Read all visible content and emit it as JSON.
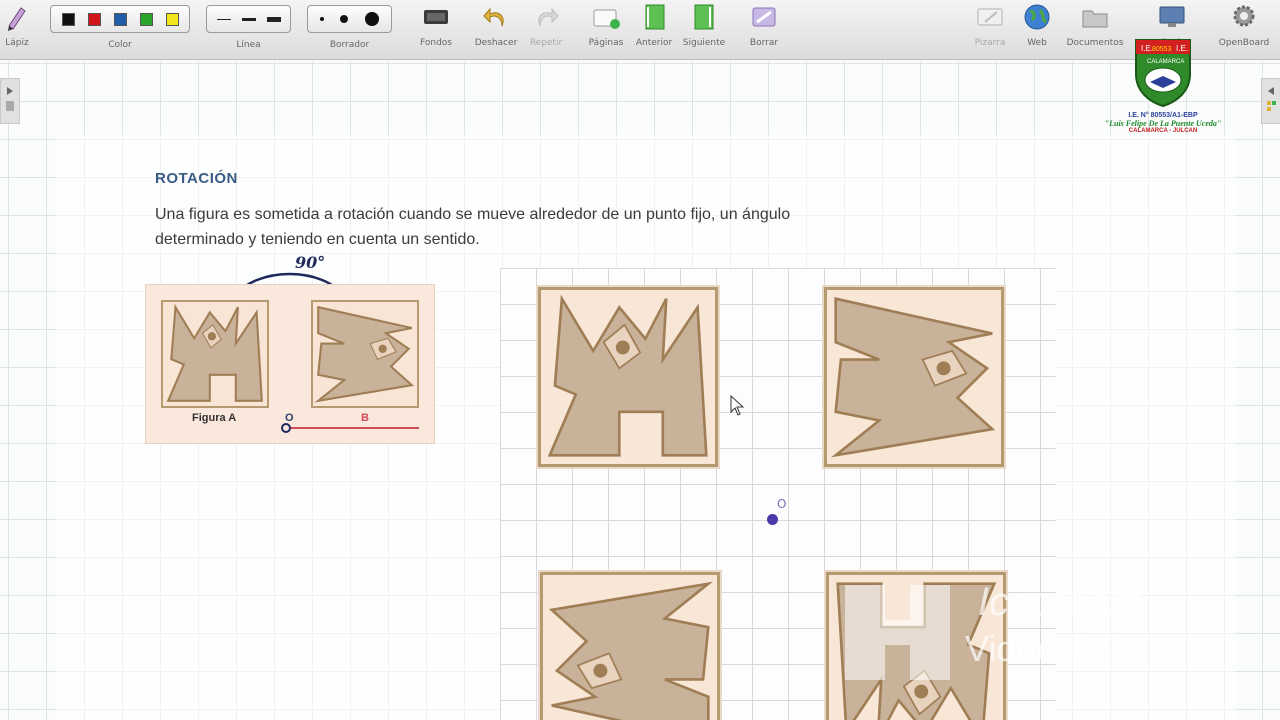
{
  "toolbar": {
    "pencil_label": "Lápiz",
    "color_label": "Color",
    "line_label": "Línea",
    "eraser_label": "Borrador",
    "backgrounds_label": "Fondos",
    "undo_label": "Deshacer",
    "redo_label": "Repetir",
    "pages_label": "Páginas",
    "previous_label": "Anterior",
    "next_label": "Siguiente",
    "erase_label": "Borrar",
    "board_label": "Pizarra",
    "web_label": "Web",
    "documents_label": "Documentos",
    "desktop_label": "ritorio",
    "openboard_label": "OpenBoard",
    "colors": [
      "#111111",
      "#d0141a",
      "#1f5fa8",
      "#2aa52a",
      "#f2e31a"
    ]
  },
  "logo": {
    "badge_left": "I.E.",
    "badge_number": "80553",
    "badge_right": "I.E.",
    "town": "CALAMARCA",
    "line1": "I.E. N° 80553/A1-EBP",
    "line2": "\"Luis Felipe De La Puente Uceda\"",
    "line3": "CALAMARCA - JULCAN"
  },
  "lesson": {
    "heading": "ROTACIÓN",
    "paragraph": "Una figura es sometida a rotación cuando se mueve alrededor de un punto fijo, un ángulo determinado y teniendo en cuenta un sentido."
  },
  "example": {
    "figure_a_label": "Figura A",
    "figure_b_label": "B",
    "origin_label": "O",
    "annotation": "90°"
  },
  "grid": {
    "origin_label": "O"
  },
  "watermark": {
    "line1": "Icecream",
    "line2": "Video Editor"
  }
}
